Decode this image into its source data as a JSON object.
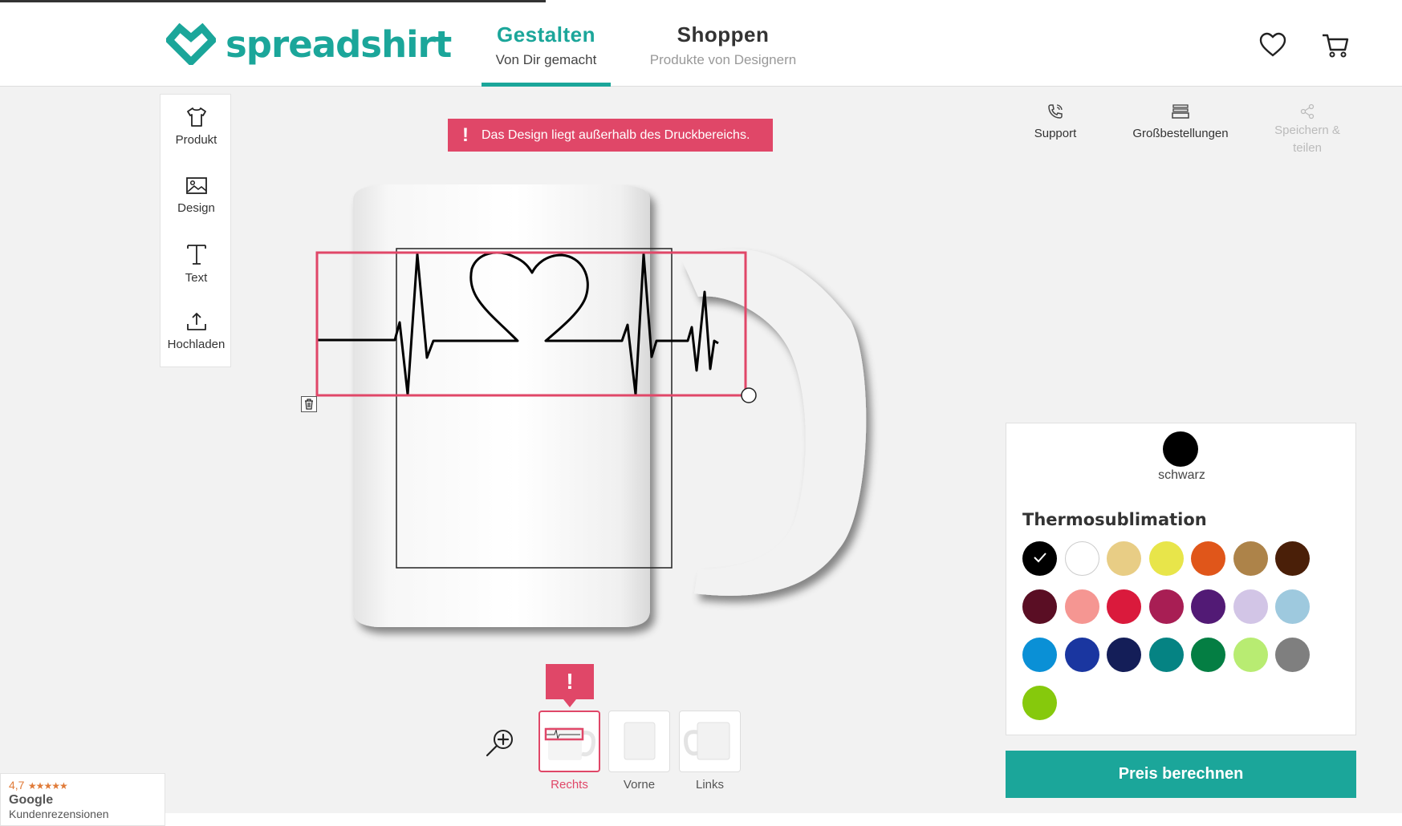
{
  "brand": {
    "name": "spreadshirt",
    "color": "#1ba69a",
    "icon": "heart-diamond-logo-icon"
  },
  "nav": {
    "tabs": [
      {
        "title": "Gestalten",
        "subtitle": "Von Dir gemacht",
        "active": true
      },
      {
        "title": "Shoppen",
        "subtitle": "Produkte von Designern",
        "active": false
      }
    ],
    "icons": [
      "heart-icon",
      "cart-icon"
    ]
  },
  "toolbar": {
    "items": [
      {
        "label": "Produkt",
        "icon": "tshirt-icon"
      },
      {
        "label": "Design",
        "icon": "image-icon"
      },
      {
        "label": "Text",
        "icon": "text-t-icon"
      },
      {
        "label": "Hochladen",
        "icon": "upload-icon"
      }
    ]
  },
  "warning": {
    "text": "Das Design liegt außerhalb des Druckbereichs.",
    "icon": "exclamation-icon",
    "color": "#e04768"
  },
  "actions": [
    {
      "label": "Support",
      "icon": "phone-icon"
    },
    {
      "label": "Großbestellungen",
      "icon": "stack-icon"
    },
    {
      "label": "Speichern &",
      "label2": "teilen",
      "icon": "share-icon",
      "disabled": true
    }
  ],
  "views": {
    "flag": "!",
    "items": [
      {
        "label": "Rechts",
        "active": true
      },
      {
        "label": "Vorne",
        "active": false
      },
      {
        "label": "Links",
        "active": false
      }
    ]
  },
  "colors": {
    "selected": {
      "name": "schwarz",
      "hex": "#000000"
    },
    "group_title": "Thermosublimation",
    "swatches": [
      "#000000",
      "#ffffff",
      "#e8cd85",
      "#e8e54a",
      "#e0561a",
      "#ad8349",
      "#4a1f08",
      "#5a0e24",
      "#f59692",
      "#da1a3c",
      "#a81e54",
      "#521a75",
      "#d2c5e6",
      "#9ec9de",
      "#0a90d6",
      "#1a36a0",
      "#141e58",
      "#058383",
      "#047e43",
      "#b8ec72",
      "#7f7f7f",
      "#86c90c"
    ]
  },
  "cta": {
    "label": "Preis berechnen"
  },
  "badge": {
    "rating": "4,7",
    "stars": "★★★★★",
    "source": "Google",
    "caption": "Kundenrezensionen"
  }
}
